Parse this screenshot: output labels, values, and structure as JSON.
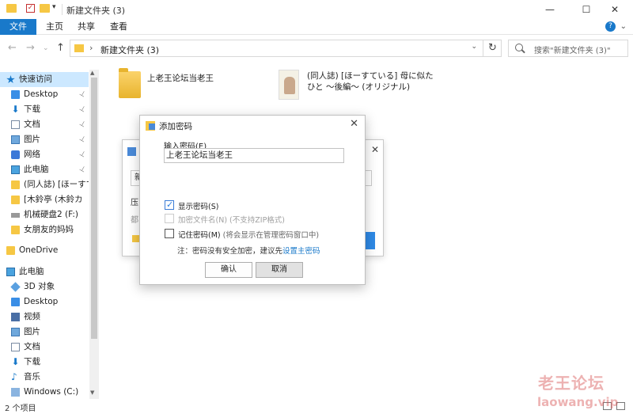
{
  "window": {
    "title": "新建文件夹 (3)",
    "minimize_icon": "—",
    "maximize_icon": "☐",
    "close_icon": "✕"
  },
  "ribbon": {
    "tabs": [
      {
        "label": "文件",
        "active": true
      },
      {
        "label": "主页",
        "active": false
      },
      {
        "label": "共享",
        "active": false
      },
      {
        "label": "查看",
        "active": false
      }
    ],
    "help": "?",
    "expand": "⌄"
  },
  "address": {
    "path": "新建文件夹 (3)",
    "separator": "›",
    "dropdown": "⌄",
    "refresh": "↻"
  },
  "nav_buttons": {
    "back": "←",
    "forward": "→",
    "recent": "⌄",
    "up": "↑"
  },
  "search": {
    "placeholder": "搜索\"新建文件夹 (3)\""
  },
  "sidebar": {
    "items": [
      {
        "label": "快速访问",
        "icon": "star-icon",
        "pinned": false,
        "selected": true
      },
      {
        "label": "Desktop",
        "icon": "desktop-icon",
        "pinned": true
      },
      {
        "label": "下载",
        "icon": "download-icon",
        "pinned": true
      },
      {
        "label": "文档",
        "icon": "document-icon",
        "pinned": true
      },
      {
        "label": "图片",
        "icon": "pictures-icon",
        "pinned": true
      },
      {
        "label": "网络",
        "icon": "network-icon",
        "pinned": true
      },
      {
        "label": "此电脑",
        "icon": "computer-icon",
        "pinned": true
      },
      {
        "label": "(同人誌) [ほーすて",
        "icon": "folder-icon",
        "pinned": false
      },
      {
        "label": "[木鈴亭 (木鈴カ",
        "icon": "folder-icon",
        "pinned": false
      },
      {
        "label": "机械硬盘2 (F:)",
        "icon": "drive-icon",
        "pinned": false
      },
      {
        "label": "女朋友的妈妈",
        "icon": "folder-icon",
        "pinned": false
      },
      {
        "label": "OneDrive",
        "icon": "onedrive-icon",
        "pinned": false
      },
      {
        "label": "此电脑",
        "icon": "computer-icon",
        "pinned": false
      },
      {
        "label": "3D 对象",
        "icon": "cube-icon",
        "pinned": false
      },
      {
        "label": "Desktop",
        "icon": "desktop-icon",
        "pinned": false
      },
      {
        "label": "视频",
        "icon": "video-icon",
        "pinned": false
      },
      {
        "label": "图片",
        "icon": "pictures-icon",
        "pinned": false
      },
      {
        "label": "文档",
        "icon": "document-icon",
        "pinned": false
      },
      {
        "label": "下载",
        "icon": "download-icon",
        "pinned": false
      },
      {
        "label": "音乐",
        "icon": "music-icon",
        "pinned": false
      },
      {
        "label": "Windows (C:)",
        "icon": "windows-drive-icon",
        "pinned": false
      }
    ],
    "pin_glyph": "📌"
  },
  "files": [
    {
      "name": "上老王论坛当老王",
      "type": "folder"
    },
    {
      "name_line1": "(同人誌) [ほーすている] 母に似た",
      "name_line2": "ひと ～後編～ (オリジナル)",
      "type": "folder-with-image"
    }
  ],
  "status": {
    "text": "2 个项目"
  },
  "bg_dialog": {
    "field": "新",
    "label1": "压",
    "label2": "都",
    "close": "✕"
  },
  "dialog": {
    "title": "添加密码",
    "close": "✕",
    "password_label": "输入密码(E)",
    "password_value": "上老王论坛当老王",
    "checkboxes": [
      {
        "label": "显示密码(S)",
        "checked": true,
        "disabled": false
      },
      {
        "label": "加密文件名(N)",
        "sub": " (不支持ZIP格式)",
        "checked": false,
        "disabled": true
      },
      {
        "label": "记住密码(M)",
        "sub": " (将会显示在管理密码窗口中)",
        "checked": false,
        "disabled": false
      }
    ],
    "note_prefix": "注：密码没有安全加密，建议先",
    "note_link": "设置主密码",
    "ok_label": "确认",
    "cancel_label": "取消"
  },
  "watermark": {
    "line1": "老王论坛",
    "line2": "laowang.vip"
  },
  "colors": {
    "accent": "#1979ca",
    "selection": "#cce8ff",
    "folder": "#f6c744"
  }
}
